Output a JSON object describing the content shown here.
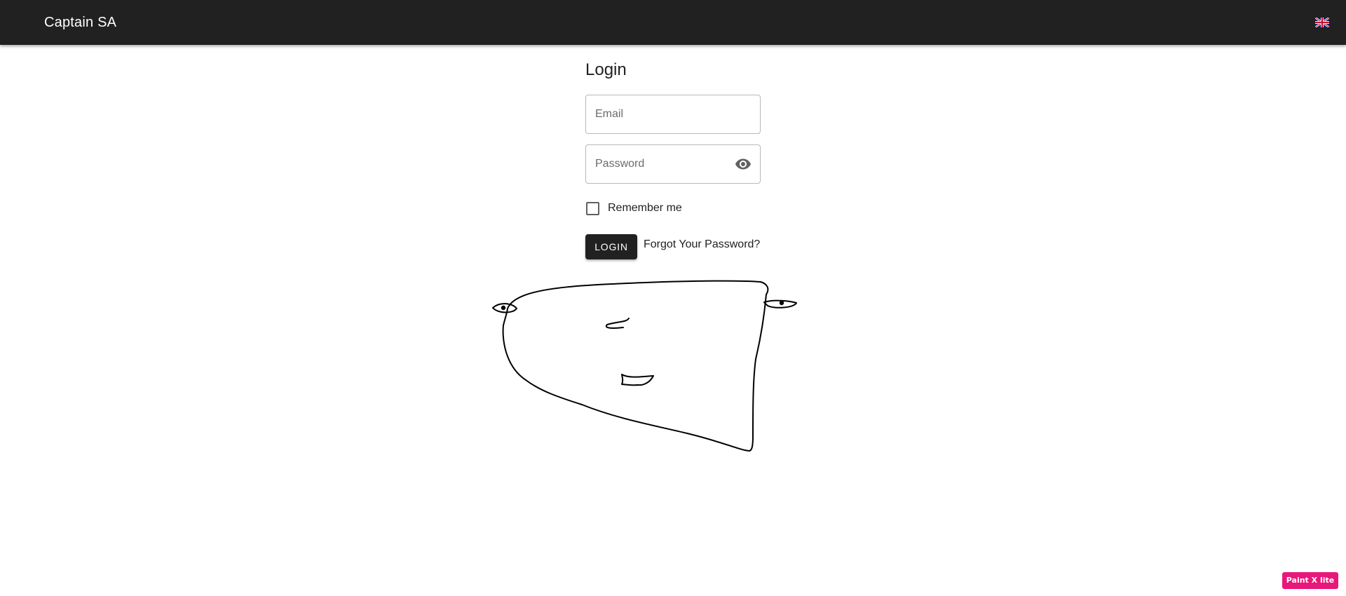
{
  "appbar": {
    "title": "Captain SA",
    "language_icon": "uk-flag-icon"
  },
  "login": {
    "title": "Login",
    "email": {
      "placeholder": "Email",
      "value": ""
    },
    "password": {
      "placeholder": "Password",
      "value": "",
      "toggle_icon": "eye-icon"
    },
    "remember_me": {
      "label": "Remember me",
      "checked": false
    },
    "submit_label": "LOGIN",
    "forgot_label": "Forgot Your Password?"
  },
  "extension_badge": {
    "label": "Paint X lite"
  },
  "colors": {
    "appbar_bg": "#212121",
    "button_bg": "#212121",
    "badge_bg": "#e8177a"
  }
}
